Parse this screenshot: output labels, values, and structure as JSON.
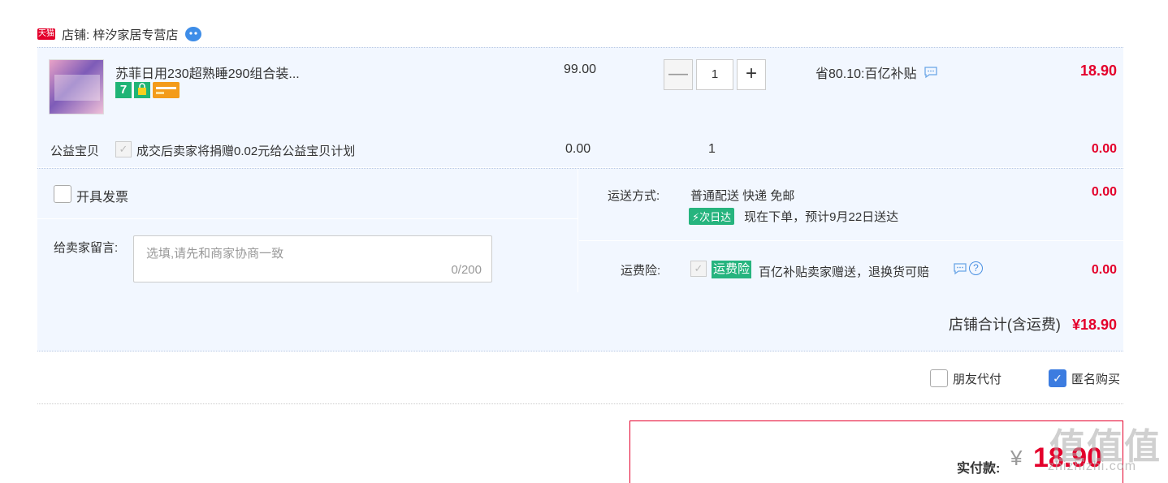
{
  "store": {
    "badge": "天猫",
    "label": "店铺: 梓汐家居专营店"
  },
  "item": {
    "title": "苏菲日用230超熟睡290组合装...",
    "service_7": "7",
    "unit_price": "99.00",
    "quantity": "1",
    "qty_minus": "—",
    "qty_plus": "+",
    "saving": "省80.10:百亿补贴",
    "total": "18.90"
  },
  "charity": {
    "label": "公益宝贝",
    "text": "成交后卖家将捐赠0.02元给公益宝贝计划",
    "price": "0.00",
    "qty": "1",
    "total": "0.00"
  },
  "invoice": {
    "label": "开具发票"
  },
  "message": {
    "label": "给卖家留言:",
    "placeholder": "选填,请先和商家协商一致",
    "counter": "0/200"
  },
  "shipping": {
    "label": "运送方式:",
    "value": "普通配送 快递 免邮",
    "next_day_badge": "次日达",
    "eta": "现在下单，预计9月22日送达",
    "price": "0.00"
  },
  "insurance": {
    "label": "运费险:",
    "badge": "运费险",
    "text": "百亿补贴卖家赠送，退换货可赔",
    "help": "?",
    "price": "0.00"
  },
  "store_total": {
    "label": "店铺合计(含运费)",
    "amount": "¥18.90"
  },
  "options": {
    "friend_pay": "朋友代付",
    "anonymous": "匿名购买",
    "anonymous_check": "✓"
  },
  "payment": {
    "label": "实付款:",
    "currency": "¥",
    "amount": "18.90"
  },
  "watermark": {
    "main": "值值值",
    "sub": "zhizhizhi.com"
  },
  "colors": {
    "price_red": "#e4002b",
    "accent_blue": "#3c7ce0",
    "green_badge": "#26b47e",
    "panel_bg": "#f2f7ff"
  }
}
